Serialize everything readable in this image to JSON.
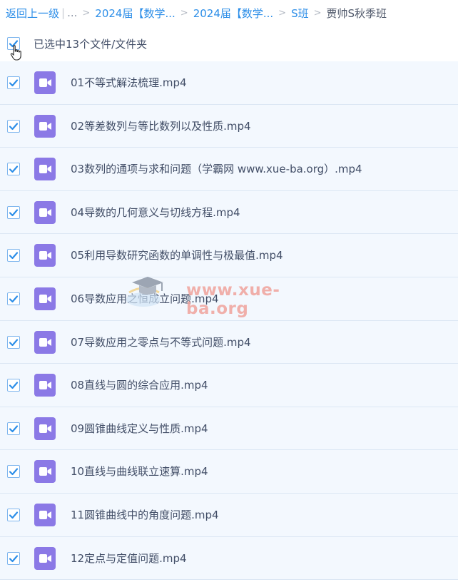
{
  "breadcrumb": {
    "back_label": "返回上一级",
    "ellipsis": "...",
    "items": [
      "2024届【数学...",
      "2024届【数学...",
      "S班",
      "贾帅S秋季班"
    ]
  },
  "selection": {
    "text": "已选中13个文件/文件夹"
  },
  "files": [
    {
      "name": "01不等式解法梳理.mp4"
    },
    {
      "name": "02等差数列与等比数列以及性质.mp4"
    },
    {
      "name": "03数列的通项与求和问题（学霸网 www.xue-ba.org）.mp4"
    },
    {
      "name": "04导数的几何意义与切线方程.mp4"
    },
    {
      "name": "05利用导数研究函数的单调性与极最值.mp4"
    },
    {
      "name": "06导数应用之恒成立问题.mp4"
    },
    {
      "name": "07导数应用之零点与不等式问题.mp4"
    },
    {
      "name": "08直线与圆的综合应用.mp4"
    },
    {
      "name": "09圆锥曲线定义与性质.mp4"
    },
    {
      "name": "10直线与曲线联立速算.mp4"
    },
    {
      "name": "11圆锥曲线中的角度问题.mp4"
    },
    {
      "name": "12定点与定值问题.mp4"
    }
  ],
  "watermark": {
    "text": "www.xue-ba.org"
  },
  "colors": {
    "accent": "#2c8ee8",
    "video_icon": "#8b79e6",
    "row_background": "#f3f8fe"
  }
}
